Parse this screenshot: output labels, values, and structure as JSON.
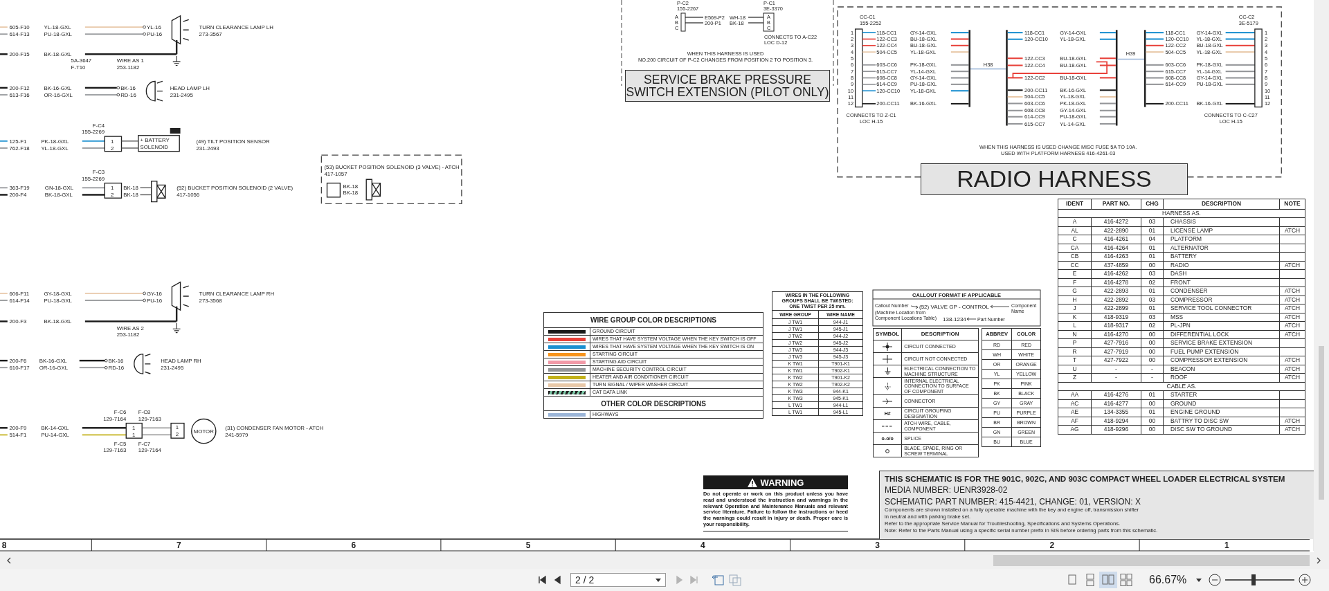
{
  "left_schematic": {
    "circuits": [
      {
        "kind": "clearance-lamp",
        "wires": [
          {
            "circuit": "605-F10",
            "wire": "YL-18-GXL",
            "pin": "YL-16",
            "color": "#e8c8a8",
            "ground": false
          },
          {
            "circuit": "614-F13",
            "wire": "PU-18-GXL",
            "pin": "PU-16",
            "color": "#939598",
            "ground": false
          },
          {
            "circuit": "200-F15",
            "wire": "BK-18-GXL",
            "color": "#1a1a1a",
            "ground": true
          }
        ],
        "component": {
          "name": "TURN CLEARANCE LAMP LH",
          "part": "273-3567"
        },
        "notes": [
          {
            "kind": "splice",
            "lines": [
              "5A-3647",
              "F-T10"
            ]
          },
          {
            "kind": "harness",
            "lines": [
              "WIRE AS 1",
              "253-1182"
            ]
          }
        ]
      },
      {
        "kind": "head-lamp",
        "wires": [
          {
            "circuit": "200-F12",
            "wire": "BK-16-GXL",
            "pin": "BK-16",
            "color": "#1a1a1a",
            "ground": false
          },
          {
            "circuit": "613-F16",
            "wire": "OR-16-GXL",
            "pin": "RD-16",
            "color": "#939598",
            "ground": false
          }
        ],
        "component": {
          "name": "HEAD LAMP LH",
          "part": "231-2495"
        }
      },
      {
        "kind": "sensor",
        "wires": [
          {
            "circuit": "125-F1",
            "wire": "PK-18-GXL",
            "color": "#1a8fd0",
            "ground": false
          },
          {
            "circuit": "762-F18",
            "wire": "YL-18-GXL",
            "color": "#939598",
            "ground": false
          }
        ],
        "connectors": [
          {
            "ident": "F-C4",
            "part": "155-2269",
            "pins": [
              "1",
              "2"
            ]
          }
        ],
        "component": {
          "name": "(49) TILT POSITION SENSOR",
          "part": "231-2493",
          "texts": [
            "+ BATTERY",
            "SOLENOID"
          ]
        }
      },
      {
        "kind": "solenoid",
        "wires": [
          {
            "circuit": "363-F19",
            "wire": "GN-18-GXL",
            "pin": "BK-18",
            "color": "#939598",
            "ground": false
          },
          {
            "circuit": "200-F4",
            "wire": "BK-18-GXL",
            "pin": "BK-18",
            "color": "#1a1a1a",
            "ground": false
          }
        ],
        "connectors": [
          {
            "ident": "F-C3",
            "part": "155-2269",
            "pins": [
              "1",
              "2"
            ]
          }
        ],
        "component": {
          "name": "(52) BUCKET POSITION SOLENOID (2 VALVE)",
          "part": "417-1056"
        }
      },
      {
        "kind": "clearance-lamp",
        "wires": [
          {
            "circuit": "606-F11",
            "wire": "GY-18-GXL",
            "pin": "GY-16",
            "color": "#e8c8a8",
            "ground": false
          },
          {
            "circuit": "614-F14",
            "wire": "PU-18-GXL",
            "pin": "PU-16",
            "color": "#939598",
            "ground": false
          },
          {
            "circuit": "200-F3",
            "wire": "BK-18-GXL",
            "color": "#1a1a1a",
            "ground": true
          }
        ],
        "component": {
          "name": "TURN CLEARANCE LAMP RH",
          "part": "273-3568"
        },
        "notes": [
          {
            "kind": "harness",
            "lines": [
              "WIRE AS 2",
              "253-1182"
            ]
          }
        ]
      },
      {
        "kind": "head-lamp",
        "wires": [
          {
            "circuit": "200-F6",
            "wire": "BK-16-GXL",
            "pin": "BK-16",
            "color": "#1a1a1a",
            "ground": false
          },
          {
            "circuit": "610-F17",
            "wire": "OR-16-GXL",
            "pin": "RD-16",
            "color": "#939598",
            "ground": false
          }
        ],
        "component": {
          "name": "HEAD LAMP RH",
          "part": "231-2495"
        }
      },
      {
        "kind": "motor",
        "wires": [
          {
            "circuit": "200-F9",
            "wire": "BK-14-GXL",
            "color": "#1a1a1a",
            "ground": false
          },
          {
            "circuit": "514-F1",
            "wire": "PU-14-GXL",
            "color": "#c2b11a",
            "ground": false
          }
        ],
        "connectors": [
          {
            "ident": "F-C6",
            "part": "129-7164",
            "pins": [
              "1",
              "1"
            ]
          },
          {
            "ident": "F-C8",
            "part": "129-7163"
          },
          {
            "ident": "F-C5",
            "part": "129-7163"
          },
          {
            "ident": "F-C7",
            "part": "129-7164"
          }
        ],
        "component": {
          "name": "(31) CONDENSER FAN MOTOR - ATCH",
          "part": "241-5979",
          "texts": [
            "MOTOR"
          ],
          "pins": [
            "1",
            "2"
          ]
        }
      }
    ],
    "optional_component": {
      "name": "(53) BUCKET POSITION SOLENOID (3 VALVE) - ATCH",
      "part": "417-1057",
      "pins": [
        "BK-18",
        "BK-18"
      ]
    }
  },
  "service_brake": {
    "title": "SERVICE BRAKE PRESSURE SWITCH EXTENSION (PILOT ONLY)",
    "connectors": [
      {
        "ident": "P-C2",
        "part": "155-2267",
        "pins": [
          "A",
          "B",
          "C"
        ]
      },
      {
        "ident": "P-C1",
        "part": "3E-3370",
        "pins": [
          "A",
          "B",
          "C"
        ]
      }
    ],
    "wires": [
      {
        "circuit": "E569-P2",
        "wire": "WH-18"
      },
      {
        "circuit": "200-P1",
        "wire": "BK-18"
      }
    ],
    "connects": [
      "CONNECTS TO A-C22",
      "LOC D-12"
    ],
    "note": [
      "WHEN THIS HARNESS IS USED",
      "NO.200 CIRCUIT OF P-C2 CHANGES FROM POSITION 2 TO POSITION 3."
    ]
  },
  "radio_harness": {
    "title": "RADIO HARNESS",
    "left_connector": {
      "ident": "CC-C1",
      "part": "155-2252",
      "connects": [
        "CONNECTS TO Z-C1",
        "LOC H-15"
      ],
      "pins": [
        {
          "number": "1",
          "wire": {
            "circuit": "118-CC1",
            "wire": "GY-14-GXL",
            "color": "#1a8fd0"
          }
        },
        {
          "number": "2",
          "wire": {
            "circuit": "122-CC3",
            "wire": "BU-18-GXL",
            "color": "#e8413a"
          }
        },
        {
          "number": "3",
          "wire": {
            "circuit": "122-CC4",
            "wire": "BU-18-GXL",
            "color": "#e8413a"
          }
        },
        {
          "number": "4",
          "wire": {
            "circuit": "504-CC5",
            "wire": "YL-18-GXL",
            "color": "#e8c8a8"
          }
        },
        {
          "number": "5"
        },
        {
          "number": "6",
          "wire": {
            "circuit": "603-CC6",
            "wire": "PK-18-GXL",
            "color": "#939598"
          }
        },
        {
          "number": "7",
          "wire": {
            "circuit": "615-CC7",
            "wire": "YL-14-GXL",
            "color": "#939598"
          }
        },
        {
          "number": "8",
          "wire": {
            "circuit": "608-CC8",
            "wire": "GY-14-GXL",
            "color": "#939598"
          }
        },
        {
          "number": "9",
          "wire": {
            "circuit": "614-CC9",
            "wire": "PU-18-GXL",
            "color": "#939598"
          }
        },
        {
          "number": "10",
          "wire": {
            "circuit": "120-CC10",
            "wire": "YL-18-GXL",
            "color": "#1a8fd0"
          }
        },
        {
          "number": "11"
        },
        {
          "number": "12",
          "wire": {
            "circuit": "200-CC11",
            "wire": "BK-16-GXL",
            "color": "#1a1a1a"
          }
        }
      ]
    },
    "splices": [
      "H38",
      "H39"
    ],
    "middle_wires": [
      {
        "circuit": "118-CC1",
        "wire": "GY-14-GXL",
        "color": "#1a8fd0"
      },
      {
        "circuit": "120-CC10",
        "wire": "YL-18-GXL",
        "color": "#1a8fd0"
      },
      {
        "circuit": "122-CC3",
        "wire": "BU-18-GXL",
        "color": "#e8413a"
      },
      {
        "circuit": "122-CC4",
        "wire": "BU-18-GXL",
        "color": "#e8413a"
      },
      {
        "circuit": "122-CC2",
        "wire": "BU-18-GXL",
        "color": "#e8413a"
      },
      {
        "circuit": "200-CC11",
        "wire": "BK-16-GXL",
        "color": "#1a1a1a"
      },
      {
        "circuit": "504-CC5",
        "wire": "YL-18-GXL",
        "color": "#e8c8a8"
      },
      {
        "circuit": "603-CC6",
        "wire": "PK-18-GXL",
        "color": "#939598"
      },
      {
        "circuit": "608-CC8",
        "wire": "GY-14-GXL",
        "color": "#939598"
      },
      {
        "circuit": "614-CC9",
        "wire": "PU-18-GXL",
        "color": "#939598"
      },
      {
        "circuit": "615-CC7",
        "wire": "YL-14-GXL",
        "color": "#939598"
      }
    ],
    "right_connector": {
      "ident": "CC-C2",
      "part": "3E-5179",
      "connects": [
        "CONNECTS TO C-C27",
        "LOC H-15"
      ],
      "pins": [
        {
          "number": "1",
          "wire": {
            "circuit": "118-CC1",
            "wire": "GY-14-GXL",
            "color": "#1a8fd0"
          }
        },
        {
          "number": "2",
          "wire": {
            "circuit": "120-CC10",
            "wire": "YL-18-GXL",
            "color": "#1a8fd0"
          }
        },
        {
          "number": "3",
          "wire": {
            "circuit": "122-CC2",
            "wire": "BU-18-GXL",
            "color": "#e8413a"
          }
        },
        {
          "number": "4",
          "wire": {
            "circuit": "504-CC5",
            "wire": "YL-18-GXL",
            "color": "#e8c8a8"
          }
        },
        {
          "number": "5"
        },
        {
          "number": "6",
          "wire": {
            "circuit": "603-CC6",
            "wire": "PK-18-GXL",
            "color": "#939598"
          }
        },
        {
          "number": "7",
          "wire": {
            "circuit": "615-CC7",
            "wire": "YL-14-GXL",
            "color": "#939598"
          }
        },
        {
          "number": "8",
          "wire": {
            "circuit": "608-CC8",
            "wire": "GY-14-GXL",
            "color": "#939598"
          }
        },
        {
          "number": "9",
          "wire": {
            "circuit": "614-CC9",
            "wire": "PU-18-GXL",
            "color": "#939598"
          }
        },
        {
          "number": "10"
        },
        {
          "number": "11"
        },
        {
          "number": "12",
          "wire": {
            "circuit": "200-CC11",
            "wire": "BK-16-GXL",
            "color": "#1a1a1a"
          }
        }
      ]
    },
    "note": [
      "WHEN THIS HARNESS IS USED CHANGE MISC FUSE 5A TO 10A.",
      "USED WITH PLATFORM HARNESS 416-4261-03"
    ]
  },
  "wire_groups": {
    "title": "WIRE GROUP COLOR DESCRIPTIONS",
    "items": [
      {
        "kind": "solid",
        "color": "#1a1a1a",
        "description": "GROUND CIRCUIT"
      },
      {
        "kind": "solid",
        "color": "#e8413a",
        "description": "WIRES THAT HAVE SYSTEM VOLTAGE WHEN THE KEY SWITCH IS OFF"
      },
      {
        "kind": "solid",
        "color": "#1a8fd0",
        "description": "WIRES THAT HAVE SYSTEM VOLTAGE WHEN THE KEY SWITCH IS ON"
      },
      {
        "kind": "solid",
        "color": "#f7941d",
        "description": "STARTING CIRCUIT"
      },
      {
        "kind": "solid",
        "color": "#f29aa8",
        "description": "STARTING AID CIRCUIT"
      },
      {
        "kind": "solid",
        "color": "#939598",
        "description": "MACHINE SECURITY CONTROL CIRCUIT"
      },
      {
        "kind": "solid",
        "color": "#c2b11a",
        "description": "HEATER AND AIR CONDITIONER CIRCUIT"
      },
      {
        "kind": "solid",
        "color": "#e8c8a8",
        "description": "TURN SIGNAL / WIPER WASHER CIRCUIT"
      },
      {
        "kind": "striped",
        "color": "#7fcaa8",
        "description": "CAT DATA LINK"
      }
    ],
    "other_title": "OTHER COLOR DESCRIPTIONS",
    "other_items": [
      {
        "kind": "solid",
        "color": "#9bb5d8",
        "description": "HIGHWAYS"
      }
    ]
  },
  "twist_table": {
    "title": "WIRES IN THE FOLLOWING GROUPS SHALL BE TWISTED: ONE TWIST PER 25 mm.",
    "columns": [
      "WIRE GROUP",
      "WIRE NAME"
    ],
    "rows": [
      [
        "J TW1",
        "944-J1"
      ],
      [
        "J TW1",
        "945-J1"
      ],
      [
        "J TW2",
        "944-J2"
      ],
      [
        "J TW2",
        "945-J2"
      ],
      [
        "J TW3",
        "944-J3"
      ],
      [
        "J TW3",
        "945-J3"
      ],
      [
        "K TW1",
        "T901-K1"
      ],
      [
        "K TW1",
        "T902-K1"
      ],
      [
        "K TW2",
        "T901-K2"
      ],
      [
        "K TW2",
        "T902-K2"
      ],
      [
        "K TW3",
        "944-K1"
      ],
      [
        "K TW3",
        "945-K1"
      ],
      [
        "L TW1",
        "944-L1"
      ],
      [
        "L TW1",
        "945-L1"
      ]
    ]
  },
  "callout_format": {
    "title": "CALLOUT FORMAT IF APPLICABLE",
    "callout_label": "Callout Number",
    "callout_hint": [
      "(Machine Location from",
      "Component Locations Table)"
    ],
    "example_name": "(52) VALVE GP - CONTROL",
    "example_part": "138-1234",
    "part_label": "Part Number",
    "name_label": [
      "Component",
      "Name"
    ]
  },
  "symbols": {
    "columns": [
      "SYMBOL",
      "DESCRIPTION"
    ],
    "rows": [
      {
        "kind": "connected",
        "description": "CIRCUIT CONNECTED"
      },
      {
        "kind": "not-connected",
        "description": "CIRCUIT NOT CONNECTED"
      },
      {
        "kind": "ground",
        "description": "ELECTRICAL CONNECTION TO MACHINE STRUCTURE"
      },
      {
        "kind": "internal-ground",
        "description": "INTERNAL ELECTRICAL CONNECTION TO SURFACE OF COMPONENT"
      },
      {
        "kind": "connector",
        "description": "CONNECTOR"
      },
      {
        "kind": "text",
        "symbol": "H#",
        "description": "CIRCUIT GROUPING DESIGNATION"
      },
      {
        "kind": "dashed",
        "description": "ATCH WIRE, CABLE, COMPONENT"
      },
      {
        "kind": "text",
        "symbol": "o-o/o",
        "description": "SPLICE"
      },
      {
        "kind": "terminal",
        "description": "BLADE, SPADE, RING OR SCREW TERMINAL"
      }
    ]
  },
  "color_abbrev": {
    "columns": [
      "ABBREV",
      "COLOR"
    ],
    "rows": [
      [
        "RD",
        "RED"
      ],
      [
        "WH",
        "WHITE"
      ],
      [
        "OR",
        "ORANGE"
      ],
      [
        "YL",
        "YELLOW"
      ],
      [
        "PK",
        "PINK"
      ],
      [
        "BK",
        "BLACK"
      ],
      [
        "GY",
        "GRAY"
      ],
      [
        "PU",
        "PURPLE"
      ],
      [
        "BR",
        "BROWN"
      ],
      [
        "GN",
        "GREEN"
      ],
      [
        "BU",
        "BLUE"
      ]
    ]
  },
  "parts_table": {
    "columns": [
      "IDENT",
      "PART NO.",
      "CHG",
      "DESCRIPTION",
      "NOTE"
    ],
    "rows": [
      {
        "kind": "section",
        "label": "HARNESS AS."
      },
      {
        "kind": "item",
        "cells": [
          "A",
          "416-4272",
          "03",
          "CHASSIS",
          ""
        ]
      },
      {
        "kind": "item",
        "cells": [
          "AL",
          "422-2890",
          "01",
          "LICENSE LAMP",
          "ATCH"
        ]
      },
      {
        "kind": "item",
        "cells": [
          "C",
          "416-4261",
          "04",
          "PLATFORM",
          ""
        ]
      },
      {
        "kind": "item",
        "cells": [
          "CA",
          "416-4264",
          "01",
          "ALTERNATOR",
          ""
        ]
      },
      {
        "kind": "item",
        "cells": [
          "CB",
          "416-4263",
          "01",
          "BATTERY",
          ""
        ]
      },
      {
        "kind": "item",
        "cells": [
          "CC",
          "437-4859",
          "00",
          "RADIO",
          "ATCH"
        ]
      },
      {
        "kind": "item",
        "cells": [
          "E",
          "416-4262",
          "03",
          "DASH",
          ""
        ]
      },
      {
        "kind": "item",
        "cells": [
          "F",
          "416-4278",
          "02",
          "FRONT",
          ""
        ]
      },
      {
        "kind": "item",
        "cells": [
          "G",
          "422-2893",
          "01",
          "CONDENSER",
          "ATCH"
        ]
      },
      {
        "kind": "item",
        "cells": [
          "H",
          "422-2892",
          "03",
          "COMPRESSOR",
          "ATCH"
        ]
      },
      {
        "kind": "item",
        "cells": [
          "J",
          "422-2899",
          "01",
          "SERVICE TOOL CONNECTOR",
          "ATCH"
        ]
      },
      {
        "kind": "item",
        "cells": [
          "K",
          "418-9319",
          "03",
          "MSS",
          "ATCH"
        ]
      },
      {
        "kind": "item",
        "cells": [
          "L",
          "418-9317",
          "02",
          "PL-JPN",
          "ATCH"
        ]
      },
      {
        "kind": "item",
        "cells": [
          "N",
          "416-4270",
          "00",
          "DIFFERENTIAL LOCK",
          "ATCH"
        ]
      },
      {
        "kind": "item",
        "cells": [
          "P",
          "427-7916",
          "00",
          "SERVICE BRAKE EXTENSION",
          ""
        ]
      },
      {
        "kind": "item",
        "cells": [
          "R",
          "427-7919",
          "00",
          "FUEL PUMP EXTENSION",
          ""
        ]
      },
      {
        "kind": "item",
        "cells": [
          "T",
          "427-7922",
          "00",
          "COMPRESSOR EXTENSION",
          "ATCH"
        ]
      },
      {
        "kind": "item",
        "cells": [
          "U",
          "-",
          "-",
          "BEACON",
          "ATCH"
        ]
      },
      {
        "kind": "item",
        "cells": [
          "Z",
          "-",
          "-",
          "ROOF",
          "ATCH"
        ]
      },
      {
        "kind": "section",
        "label": "CABLE AS."
      },
      {
        "kind": "item",
        "cells": [
          "AA",
          "416-4276",
          "01",
          "STARTER",
          ""
        ]
      },
      {
        "kind": "item",
        "cells": [
          "AC",
          "416-4277",
          "00",
          "GROUND",
          ""
        ]
      },
      {
        "kind": "item",
        "cells": [
          "AE",
          "134-3355",
          "01",
          "ENGINE GROUND",
          ""
        ]
      },
      {
        "kind": "item",
        "cells": [
          "AF",
          "418-9294",
          "00",
          "BATTRY TO DISC SW",
          "ATCH"
        ]
      },
      {
        "kind": "item",
        "cells": [
          "AG",
          "418-9296",
          "00",
          "DISC SW TO GROUND",
          "ATCH"
        ]
      }
    ]
  },
  "warning": {
    "title": "WARNING",
    "text": "Do not operate or work on this product unless you have read and understood the instruction and warnings in the relevant Operation and Maintenance Manuals and relevant service literature. Failure to follow the instructions or heed the warnings could result in injury or death. Proper care is your responsibility."
  },
  "title_block": {
    "heading": "THIS SCHEMATIC IS FOR THE 901C, 902C, AND 903C COMPACT WHEEL LOADER ELECTRICAL SYSTEM",
    "lines": [
      "MEDIA NUMBER: UENR3928-02",
      "SCHEMATIC PART NUMBER: 415-4421, CHANGE: 01, VERSION: X"
    ],
    "notes": [
      "Components are shown installed on a fully operable machine with the key and engine off, transmission shifter",
      "in neutral and with parking brake set.",
      "Refer to the appropriate Service Manual for Troubleshooting, Specifications and Systems Operations.",
      "Note: Refer to the Parts Manual using a specific serial number prefix in SIS before ordering parts from this schematic."
    ]
  },
  "zone_ruler": [
    "8",
    "7",
    "6",
    "5",
    "4",
    "3",
    "2",
    "1"
  ],
  "toolbar": {
    "nav": [
      {
        "kind": "first",
        "disabled": false
      },
      {
        "kind": "previous",
        "disabled": false
      },
      {
        "kind": "next",
        "disabled": true
      },
      {
        "kind": "last",
        "disabled": true
      }
    ],
    "page": "2 / 2",
    "view_modes": [
      {
        "kind": "single",
        "selected": false
      },
      {
        "kind": "continuous",
        "selected": false
      },
      {
        "kind": "two-page",
        "selected": true
      },
      {
        "kind": "two-continuous",
        "selected": false
      }
    ],
    "zoom": "66.67%",
    "zoom_slider": {
      "level": 0.41
    }
  }
}
